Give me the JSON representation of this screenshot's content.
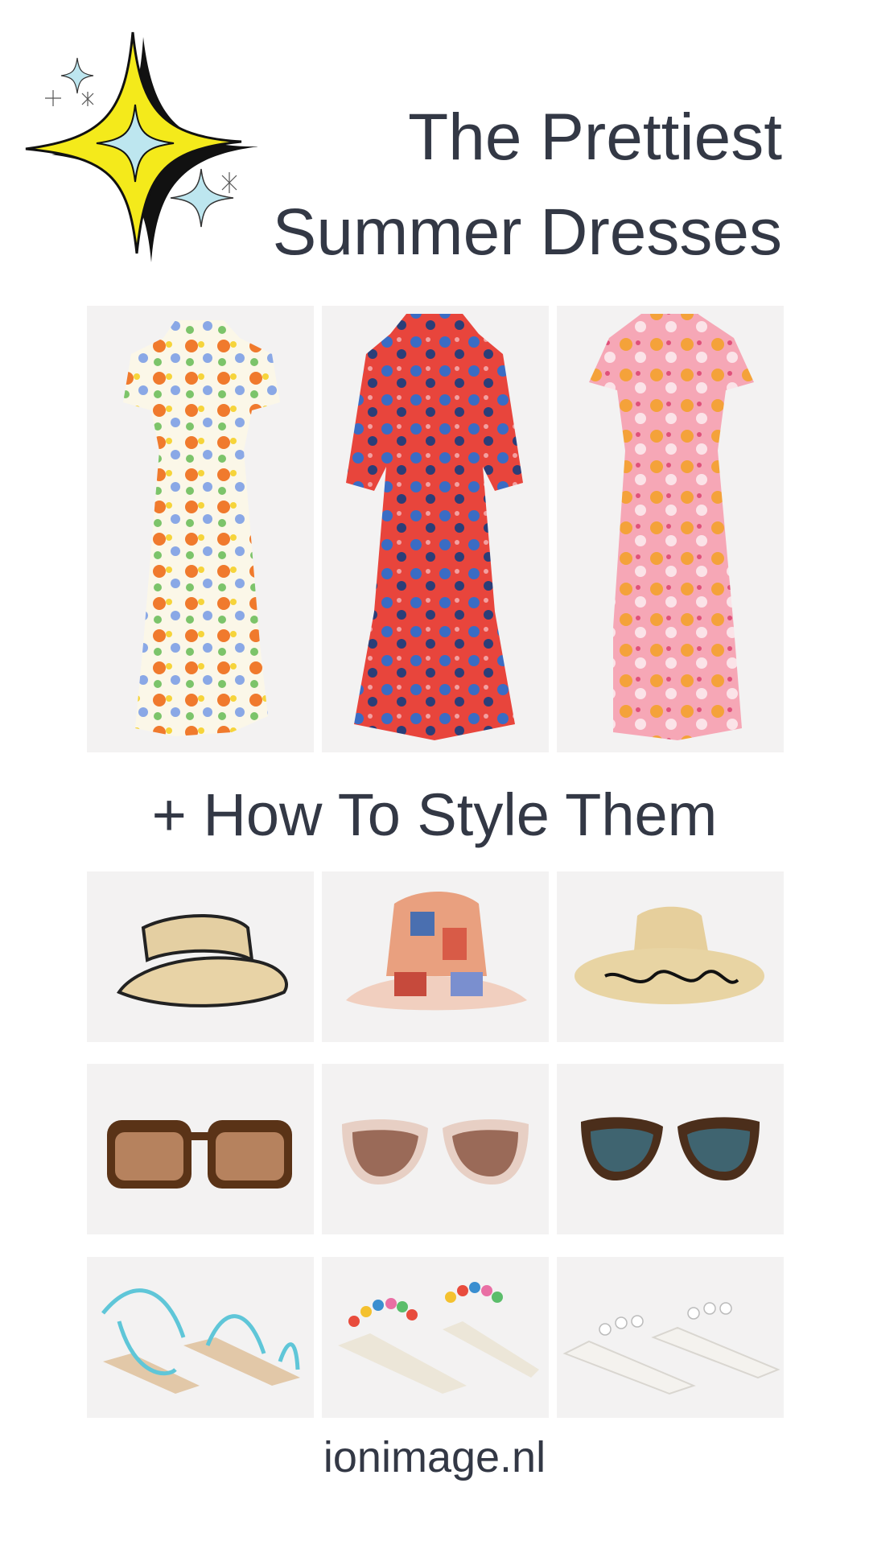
{
  "header": {
    "title_line1": "The Prettiest",
    "title_line2": "Summer Dresses",
    "decoration": "sparkle-star-icon"
  },
  "dresses": [
    {
      "name": "floral-wrap-maxi-dress"
    },
    {
      "name": "red-blue-print-tiered-dress"
    },
    {
      "name": "pink-orange-floral-dress"
    }
  ],
  "subheading": "+ How To Style Them",
  "accessories": {
    "hats": [
      {
        "name": "straw-visor"
      },
      {
        "name": "patchwork-bucket-hat"
      },
      {
        "name": "straw-sun-hat"
      }
    ],
    "sunglasses": [
      {
        "name": "tortoise-square-sunglasses"
      },
      {
        "name": "pink-cat-eye-sunglasses"
      },
      {
        "name": "tortoise-cat-eye-sunglasses"
      }
    ],
    "sandals": [
      {
        "name": "blue-crystal-sandals"
      },
      {
        "name": "beaded-white-sandals"
      },
      {
        "name": "clear-embellished-sandals"
      }
    ]
  },
  "footer": {
    "site": "ionimage.nl"
  },
  "colors": {
    "text": "#333845",
    "tile_bg": "#f3f2f2",
    "star_yellow": "#f4ea1b",
    "star_blue": "#bde6ef"
  }
}
